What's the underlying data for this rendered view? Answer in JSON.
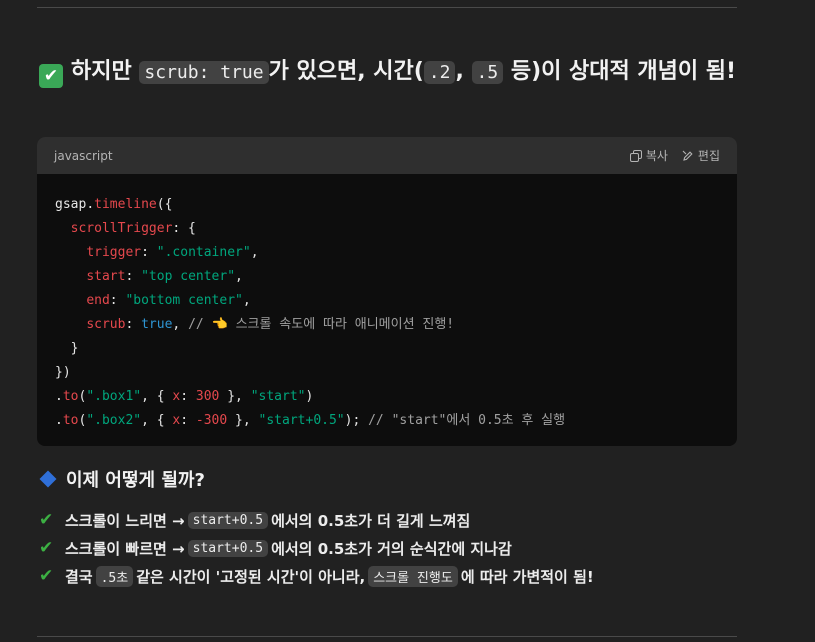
{
  "heading": {
    "pre": "하지만 ",
    "code1": "scrub: true",
    "mid": "가 있으면, 시간(",
    "code2": ".2",
    "comma": ", ",
    "code3": ".5",
    "tail": " 등)이 상대적 개념이 됨!"
  },
  "code_block": {
    "language": "javascript",
    "copy_label": "복사",
    "edit_label": "편집",
    "lines": {
      "l1_obj": "gsap",
      "l1_fn": "timeline",
      "l2_key": "scrollTrigger",
      "l3_key": "trigger",
      "l3_val": "\".container\"",
      "l4_key": "start",
      "l4_val": "\"top center\"",
      "l5_key": "end",
      "l5_val": "\"bottom center\"",
      "l6_key": "scrub",
      "l6_val": "true",
      "l6_comment": "// ",
      "l6_hand": "👈",
      "l6_comment_text": " 스크롤 속도에 따라 애니메이션 진행!",
      "l9_fn": "to",
      "l9_sel": "\".box1\"",
      "l9_key": "x",
      "l9_num": "300",
      "l9_label": "\"start\"",
      "l10_fn": "to",
      "l10_sel": "\".box2\"",
      "l10_key": "x",
      "l10_num": "-300",
      "l10_label": "\"start+0.5\"",
      "l10_comment": "// \"start\"에서 0.5초 후 실행"
    }
  },
  "sub_heading": "이제 어떻게 될까?",
  "bullets": [
    {
      "pre": "스크롤이 느리면 → ",
      "code": "start+0.5",
      "post": "에서의 0.5초가 더 길게 느껴짐"
    },
    {
      "pre": "스크롤이 빠르면 → ",
      "code": "start+0.5",
      "post": "에서의 0.5초가 거의 순식간에 지나감"
    },
    {
      "pre": "결국 ",
      "code": ".5초",
      "mid": " 같은 시간이 '고정된 시간'이 아니라, ",
      "code2": "스크롤 진행도",
      "post": "에 따라 가변적이 됨!"
    }
  ],
  "colors": {
    "check": "#3aa857",
    "string": "#00a67d",
    "keyword": "#2e95d3",
    "red": "#e5484d",
    "diamond": "#2f6fd8"
  },
  "icons": [
    "check-mark-icon",
    "copy-icon",
    "edit-pencil-icon",
    "diamond-icon",
    "check-icon"
  ]
}
